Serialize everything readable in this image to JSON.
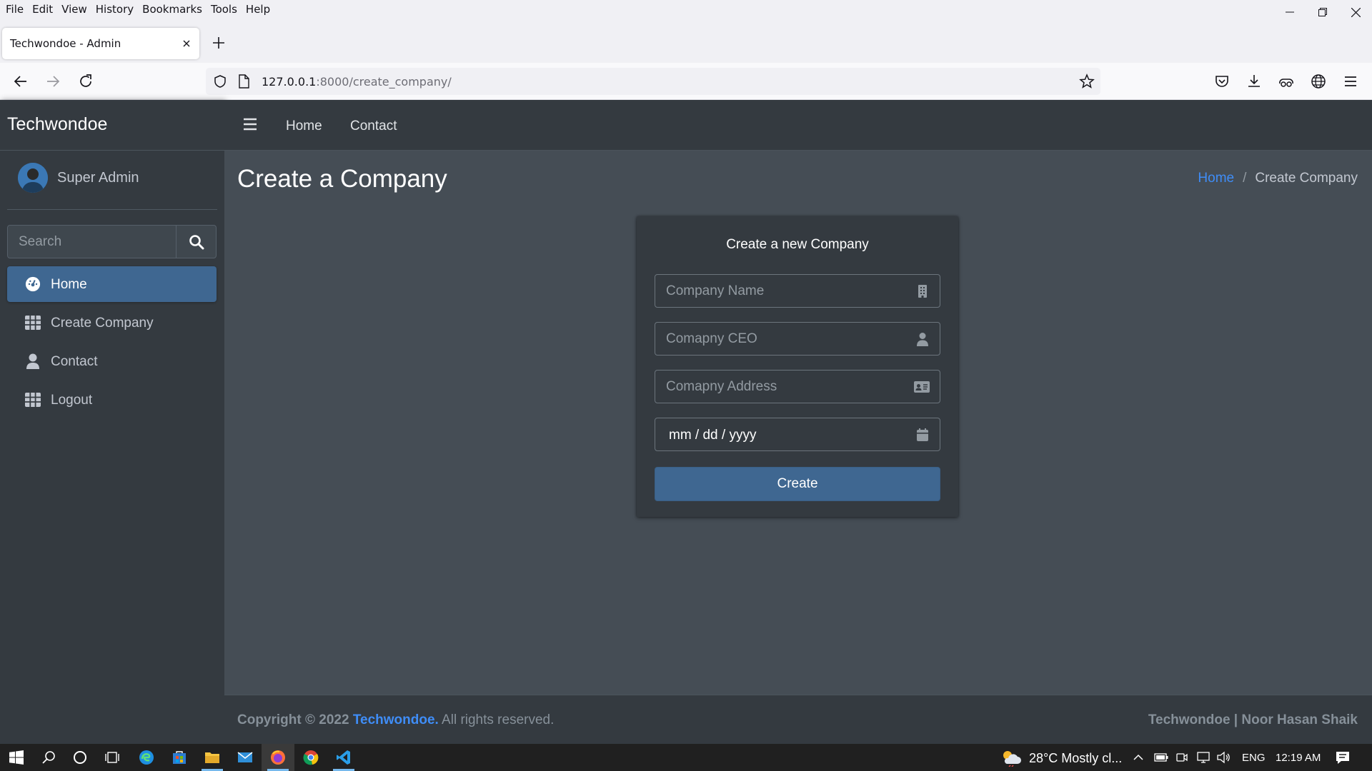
{
  "browser": {
    "menu": [
      "File",
      "Edit",
      "View",
      "History",
      "Bookmarks",
      "Tools",
      "Help"
    ],
    "tab_title": "Techwondoe - Admin",
    "url_host": "127.0.0.1",
    "url_rest": ":8000/create_company/"
  },
  "app": {
    "brand": "Techwondoe",
    "user_name": "Super Admin",
    "search_placeholder": "Search",
    "sidebar_items": [
      {
        "label": "Home",
        "icon": "dashboard-icon",
        "active": true
      },
      {
        "label": "Create Company",
        "icon": "table-icon",
        "active": false
      },
      {
        "label": "Contact",
        "icon": "user-icon",
        "active": false
      },
      {
        "label": "Logout",
        "icon": "table-icon",
        "active": false
      }
    ],
    "topnav": [
      "Home",
      "Contact"
    ],
    "page_title": "Create a Company",
    "breadcrumb": {
      "home": "Home",
      "sep": "/",
      "current": "Create Company"
    },
    "form": {
      "title": "Create a new Company",
      "name_placeholder": "Company Name",
      "ceo_placeholder": "Comapny CEO",
      "address_placeholder": "Comapny Address",
      "date_placeholder": "mm / dd / yyyy",
      "submit_label": "Create"
    },
    "footer": {
      "copyright": "Copyright © 2022",
      "brand_link": "Techwondoe.",
      "rights": "All rights reserved.",
      "right_text": "Techwondoe | Noor Hasan Shaik"
    },
    "colors": {
      "sidebar_bg": "#343a40",
      "content_bg": "#454d55",
      "accent": "#3f6791",
      "link": "#3f8df7"
    }
  },
  "taskbar": {
    "weather": "28°C  Mostly cl...",
    "lang": "ENG",
    "time": "12:19 AM"
  }
}
